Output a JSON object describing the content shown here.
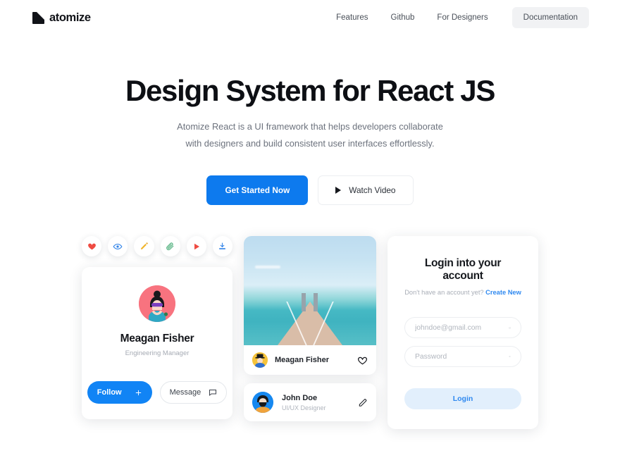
{
  "brand": {
    "name": "atomize",
    "logo_icon": "atomize-logo-icon"
  },
  "nav": {
    "links": [
      {
        "label": "Features"
      },
      {
        "label": "Github"
      },
      {
        "label": "For Designers"
      }
    ],
    "cta": {
      "label": "Documentation"
    }
  },
  "hero": {
    "title": "Design System for React JS",
    "subtitle": "Atomize React is a UI framework that helps developers collaborate with designers and build consistent user interfaces effortlessly.",
    "primary_button": "Get Started Now",
    "secondary_button": "Watch Video",
    "secondary_icon": "play-icon"
  },
  "showcase": {
    "icon_row": [
      {
        "name": "heart-icon",
        "color": "#ef4b42"
      },
      {
        "name": "eye-icon",
        "color": "#2f82e8"
      },
      {
        "name": "pencil-icon",
        "color": "#f0b429"
      },
      {
        "name": "paperclip-icon",
        "color": "#4cae7a"
      },
      {
        "name": "play-icon",
        "color": "#ef4b42"
      },
      {
        "name": "download-icon",
        "color": "#2f82e8"
      }
    ],
    "profile": {
      "name": "Meagan Fisher",
      "role": "Engineering Manager",
      "avatar_icon": "avatar-meagan",
      "follow_label": "Follow",
      "follow_icon": "plus-icon",
      "message_label": "Message",
      "message_icon": "chat-bubble-icon"
    },
    "photo_card": {
      "image_alt": "pier-photo",
      "author": "Meagan Fisher",
      "author_avatar": "avatar-meagan-small",
      "action_icon": "heart-outline-icon"
    },
    "person_card": {
      "name": "John Doe",
      "role": "UI/UX Designer",
      "avatar": "avatar-john",
      "action_icon": "pencil-edit-icon"
    },
    "login": {
      "title": "Login into your account",
      "subtitle_text": "Don't have an account yet?",
      "subtitle_link": "Create New",
      "email_placeholder": "johndoe@gmail.com",
      "email_value": "",
      "email_icon": "envelope-icon",
      "password_placeholder": "Password",
      "password_value": "",
      "password_icon": "eye-icon",
      "submit_label": "Login"
    }
  },
  "colors": {
    "accent_blue": "#0d7aee",
    "link_blue": "#2f89f0",
    "login_button_bg": "#e2effc",
    "nav_cta_bg": "#f1f2f4",
    "page_bg": "#ffffff"
  }
}
